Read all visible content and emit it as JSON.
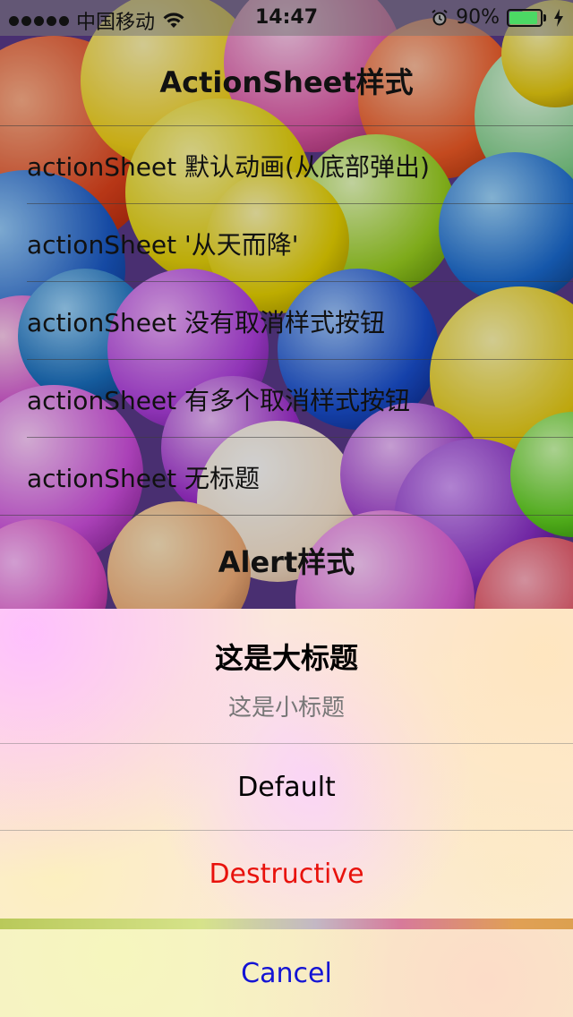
{
  "status_bar": {
    "carrier": "中国移动",
    "time": "14:47",
    "battery_percent": "90%",
    "battery_level": 0.9,
    "battery_color": "#4cd964",
    "icons": [
      "signal-dots-icon",
      "wifi-icon",
      "alarm-icon",
      "battery-icon",
      "charging-bolt-icon"
    ]
  },
  "list": {
    "section1_title": "ActionSheet样式",
    "items": [
      {
        "label": "actionSheet 默认动画(从底部弹出)"
      },
      {
        "label": "actionSheet '从天而降'"
      },
      {
        "label": "actionSheet 没有取消样式按钮"
      },
      {
        "label": "actionSheet 有多个取消样式按钮"
      },
      {
        "label": "actionSheet 无标题"
      }
    ],
    "section2_title": "Alert样式"
  },
  "action_sheet": {
    "title": "这是大标题",
    "subtitle": "这是小标题",
    "default_label": "Default",
    "destructive_label": "Destructive",
    "cancel_label": "Cancel",
    "colors": {
      "default": "#000000",
      "destructive": "#e8120c",
      "cancel": "#1414d4"
    }
  }
}
